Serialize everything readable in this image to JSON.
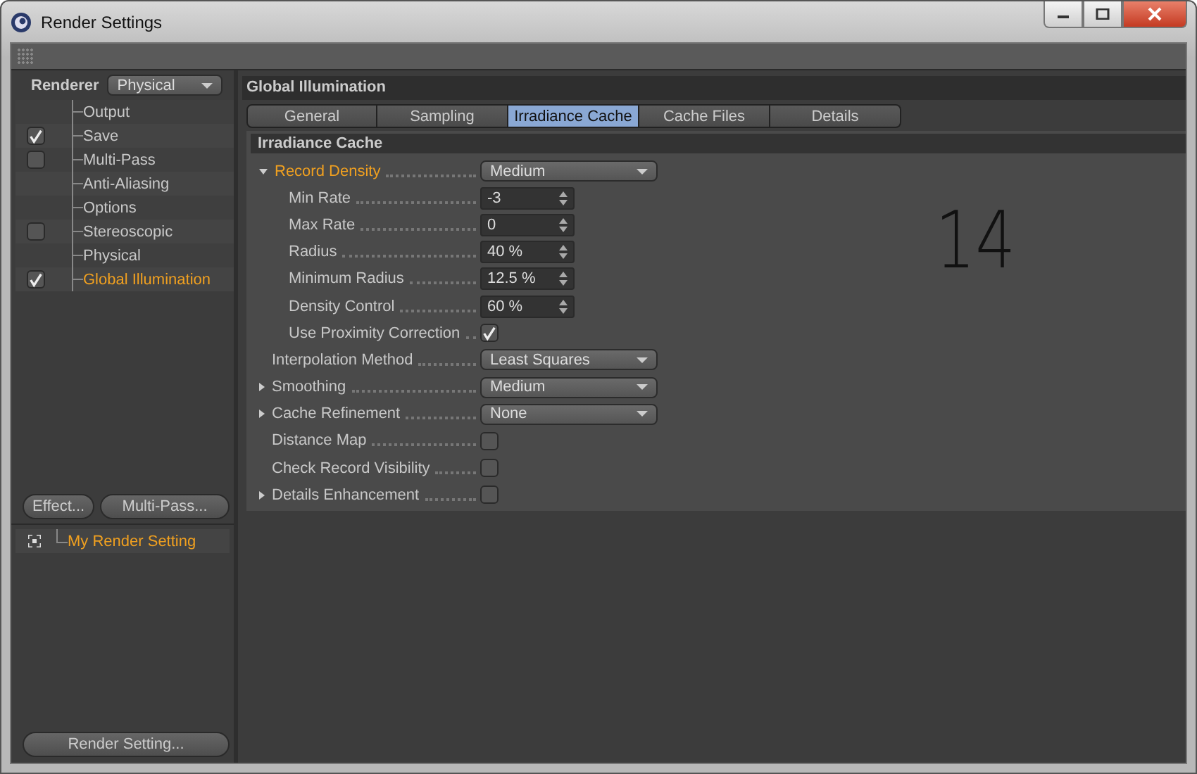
{
  "window": {
    "title": "Render Settings"
  },
  "renderer": {
    "label": "Renderer",
    "value": "Physical"
  },
  "sidebar": {
    "items": [
      {
        "label": "Output",
        "kind": "plain",
        "selected": false
      },
      {
        "label": "Save",
        "kind": "toggle",
        "checked": true,
        "selected": false
      },
      {
        "label": "Multi-Pass",
        "kind": "toggle",
        "checked": false,
        "selected": false
      },
      {
        "label": "Anti-Aliasing",
        "kind": "plain",
        "selected": false
      },
      {
        "label": "Options",
        "kind": "plain",
        "selected": false
      },
      {
        "label": "Stereoscopic",
        "kind": "toggle",
        "checked": false,
        "selected": false
      },
      {
        "label": "Physical",
        "kind": "plain",
        "selected": false
      },
      {
        "label": "Global Illumination",
        "kind": "toggle",
        "checked": true,
        "selected": true
      }
    ]
  },
  "buttons": [
    "Effect...",
    "Multi-Pass..."
  ],
  "presets": [
    {
      "label": "My Render Setting",
      "selected": true
    }
  ],
  "bottom_button": "Render Setting...",
  "panel": {
    "title": "Global Illumination",
    "tabs": [
      {
        "label": "General",
        "selected": false
      },
      {
        "label": "Sampling",
        "selected": false
      },
      {
        "label": "Irradiance Cache",
        "selected": true
      },
      {
        "label": "Cache Files",
        "selected": false
      },
      {
        "label": "Details",
        "selected": false
      }
    ],
    "section": "Irradiance Cache",
    "params": [
      {
        "label": "Record Density",
        "kind": "dropdown",
        "value": "Medium",
        "expanded": true,
        "selected": true,
        "children": [
          {
            "label": "Min Rate",
            "kind": "number",
            "value": "-3"
          },
          {
            "label": "Max Rate",
            "kind": "number",
            "value": "0"
          },
          {
            "label": "Radius",
            "kind": "number",
            "value": "40 %"
          },
          {
            "label": "Minimum Radius",
            "kind": "number",
            "value": "12.5 %"
          },
          {
            "label": "Density Control",
            "kind": "number",
            "value": "60 %"
          },
          {
            "label": "Use Proximity Correction",
            "kind": "checkbox",
            "checked": true
          }
        ]
      },
      {
        "label": "Interpolation Method",
        "kind": "dropdown",
        "value": "Least Squares",
        "selected": false
      },
      {
        "label": "Smoothing",
        "kind": "dropdown",
        "value": "Medium",
        "expanded": false,
        "selected": false
      },
      {
        "label": "Cache Refinement",
        "kind": "dropdown",
        "value": "None",
        "expanded": false,
        "selected": false
      },
      {
        "label": "Distance Map",
        "kind": "checkbox",
        "checked": false,
        "selected": false
      },
      {
        "label": "Check Record Visibility",
        "kind": "checkbox",
        "checked": false,
        "selected": false
      },
      {
        "label": "Details Enhancement",
        "kind": "checkbox",
        "checked": false,
        "expanded": false,
        "selected": false
      }
    ]
  },
  "annotation": "14"
}
